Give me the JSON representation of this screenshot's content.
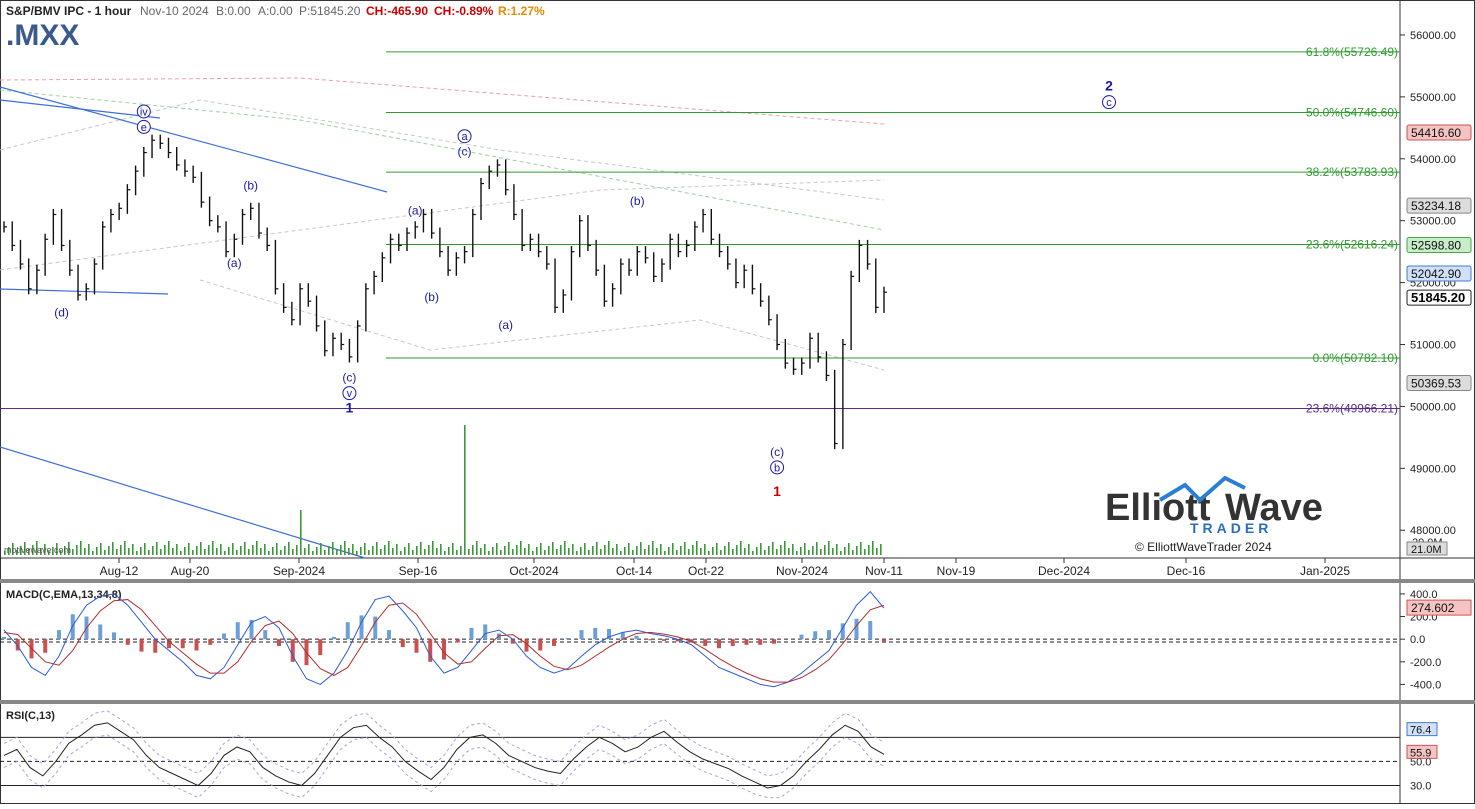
{
  "header": {
    "symbol_line": "S&P/BMV IPC - 1 hour",
    "date": "Nov-10 2024",
    "bid": "B:0.00",
    "ask": "A:0.00",
    "price": "P:51845.20",
    "change_abs": "CH:-465.90",
    "change_pct": "CH:-0.89%",
    "range_pct": "R:1.27%",
    "ticker": ".MXX",
    "watermark": "motivewave.com"
  },
  "colors": {
    "up": "#cc0000",
    "range": "#e68a00",
    "wave_blue": "#1a1aa6",
    "wave_red": "#cc0000",
    "fib_green": "#2e9b2e",
    "fib_purple": "#5a2a8a",
    "trend_blue": "#3d6fd9",
    "macd_line": "#2e5bd9",
    "signal_line": "#b03030",
    "hist_pos": "#6a9fd8",
    "hist_neg": "#c85050",
    "rsi_line": "#222222"
  },
  "logo": {
    "word1": "Elliott",
    "word2": "Wave",
    "word3": "TRADER",
    "copyright": "© ElliottWaveTrader 2024"
  },
  "chart_data": [
    {
      "type": "line",
      "title": "S&P/BMV IPC - 1 hour",
      "ylim": [
        47600,
        56500
      ],
      "x_tick_labels": [
        "Aug-12",
        "Aug-20",
        "Sep-2024",
        "Sep-16",
        "Oct-2024",
        "Oct-14",
        "Oct-22",
        "Nov-2024",
        "Nov-11",
        "Nov-19",
        "Dec-2024",
        "Dec-16",
        "Jan-2025"
      ],
      "y_tick_labels": [
        "56000.00",
        "55000.00",
        "54000.00",
        "53000.00",
        "52000.00",
        "51000.00",
        "50000.00",
        "49000.00",
        "48000.00"
      ],
      "price_series": [
        52900,
        52600,
        52300,
        51900,
        52200,
        52700,
        53100,
        52600,
        52200,
        51800,
        51900,
        52300,
        52900,
        53100,
        53200,
        53500,
        53800,
        54100,
        54300,
        54250,
        54100,
        53900,
        53800,
        53700,
        53300,
        53000,
        52900,
        52500,
        52700,
        53100,
        53200,
        52800,
        52600,
        51900,
        51600,
        51400,
        51900,
        51700,
        51300,
        50900,
        51100,
        51000,
        50800,
        51300,
        51900,
        52100,
        52400,
        52700,
        52600,
        52800,
        52900,
        53100,
        52800,
        52500,
        52200,
        52400,
        52500,
        53100,
        53600,
        53800,
        53900,
        53500,
        53100,
        52600,
        52700,
        52500,
        52300,
        51600,
        51800,
        52500,
        53000,
        52600,
        52200,
        51700,
        51900,
        52300,
        52200,
        52500,
        52400,
        52100,
        52300,
        52700,
        52500,
        52600,
        52900,
        53100,
        52700,
        52500,
        52300,
        52000,
        52200,
        51900,
        51700,
        51400,
        51000,
        50700,
        50600,
        50700,
        51100,
        50800,
        50500,
        49400,
        51000,
        52100,
        52600,
        52300,
        51600,
        51845
      ],
      "fib_levels": [
        {
          "label": "61.8%(55726.49)",
          "value": 55726.49
        },
        {
          "label": "50.0%(54746.60)",
          "value": 54746.6
        },
        {
          "label": "38.2%(53783.93)",
          "value": 53783.93
        },
        {
          "label": "23.6%(52616.24)",
          "value": 52616.24
        },
        {
          "label": "0.0%(50782.10)",
          "value": 50782.1
        },
        {
          "label": "23.6%(49966.21)",
          "value": 49966.21
        }
      ],
      "price_tags": [
        {
          "label": "54416.60",
          "value": 54416.6,
          "style": "red"
        },
        {
          "label": "53234.18",
          "value": 53234.18,
          "style": "gray"
        },
        {
          "label": "52598.80",
          "value": 52598.8,
          "style": "green"
        },
        {
          "label": "52042.90",
          "value": 52042.9,
          "style": "blue"
        },
        {
          "label": "51845.20",
          "value": 51845.2,
          "style": "last"
        },
        {
          "label": "50369.53",
          "value": 50369.53,
          "style": "gray"
        }
      ],
      "volume_labels": [
        "29.0M",
        "21.0M"
      ],
      "wave_labels": [
        {
          "text": "(d)",
          "x_index": 7,
          "value": 51450,
          "style": "blue"
        },
        {
          "text": "iv",
          "x_index": 17,
          "value": 54700,
          "style": "circle"
        },
        {
          "text": "e",
          "x_index": 17,
          "value": 54450,
          "style": "circle"
        },
        {
          "text": "(a)",
          "x_index": 28,
          "value": 52250,
          "style": "blue"
        },
        {
          "text": "(b)",
          "x_index": 30,
          "value": 53500,
          "style": "blue"
        },
        {
          "text": "(c)",
          "x_index": 42,
          "value": 50400,
          "style": "blue"
        },
        {
          "text": "v",
          "x_index": 42,
          "value": 50150,
          "style": "circle"
        },
        {
          "text": "1",
          "x_index": 42,
          "value": 49900,
          "style": "bold_blue"
        },
        {
          "text": "(a)",
          "x_index": 50,
          "value": 53100,
          "style": "blue"
        },
        {
          "text": "(b)",
          "x_index": 52,
          "value": 51700,
          "style": "blue"
        },
        {
          "text": "a",
          "x_index": 56,
          "value": 54300,
          "style": "circle"
        },
        {
          "text": "(c)",
          "x_index": 56,
          "value": 54050,
          "style": "blue"
        },
        {
          "text": "(a)",
          "x_index": 61,
          "value": 51250,
          "style": "blue"
        },
        {
          "text": "(b)",
          "x_index": 77,
          "value": 53250,
          "style": "blue"
        },
        {
          "text": "(c)",
          "x_index": 94,
          "value": 49200,
          "style": "blue"
        },
        {
          "text": "b",
          "x_index": 94,
          "value": 48950,
          "style": "circle"
        },
        {
          "text": "1",
          "x_index": 94,
          "value": 48550,
          "style": "bold_red"
        },
        {
          "text": "2",
          "x_index": 123,
          "value": 55100,
          "style": "bold_blue"
        },
        {
          "text": "c",
          "x_index": 123,
          "value": 54850,
          "style": "circle"
        }
      ]
    },
    {
      "type": "bar",
      "title": "MACD(C,EMA,13,34,8)",
      "ylim": [
        -520,
        470
      ],
      "y_tick_labels": [
        "400.0",
        "200.0",
        "0.0",
        "-200.0",
        "-400.0"
      ],
      "last_value_label": "274.602",
      "macd": [
        80,
        -60,
        -250,
        -320,
        -150,
        120,
        300,
        380,
        400,
        300,
        150,
        0,
        -100,
        -200,
        -320,
        -350,
        -250,
        -50,
        150,
        200,
        100,
        -150,
        -350,
        -400,
        -300,
        -100,
        150,
        350,
        380,
        250,
        100,
        -150,
        -300,
        -250,
        -100,
        50,
        80,
        0,
        -150,
        -250,
        -300,
        -260,
        -150,
        -50,
        20,
        60,
        80,
        50,
        30,
        0,
        -50,
        -150,
        -250,
        -300,
        -350,
        -400,
        -420,
        -380,
        -300,
        -200,
        -100,
        100,
        300,
        420,
        274.602
      ],
      "signal": [
        60,
        40,
        -80,
        -200,
        -230,
        -100,
        100,
        250,
        340,
        350,
        260,
        120,
        -20,
        -120,
        -220,
        -300,
        -300,
        -200,
        -20,
        120,
        160,
        50,
        -120,
        -260,
        -320,
        -250,
        -60,
        150,
        300,
        320,
        220,
        50,
        -120,
        -220,
        -200,
        -80,
        30,
        40,
        -40,
        -150,
        -240,
        -270,
        -230,
        -150,
        -70,
        0,
        50,
        60,
        45,
        20,
        -20,
        -90,
        -170,
        -240,
        -300,
        -350,
        -380,
        -380,
        -340,
        -270,
        -180,
        -40,
        120,
        260,
        300
      ],
      "hist": [
        20,
        -100,
        -170,
        -120,
        80,
        220,
        200,
        130,
        60,
        -50,
        -110,
        -120,
        -80,
        -80,
        -100,
        -50,
        50,
        150,
        170,
        80,
        -60,
        -200,
        -230,
        -140,
        20,
        150,
        210,
        200,
        80,
        -70,
        -120,
        -200,
        -180,
        -30,
        100,
        130,
        50,
        -40,
        -110,
        -100,
        -60,
        10,
        80,
        100,
        90,
        60,
        30,
        -10,
        -15,
        -20,
        -30,
        -60,
        -80,
        -60,
        -50,
        -50,
        -40,
        0,
        40,
        70,
        80,
        140,
        180,
        160,
        -25
      ]
    },
    {
      "type": "line",
      "title": "RSI(C,13)",
      "ylim": [
        18,
        96
      ],
      "y_tick_labels": [
        "50.0",
        "30.0"
      ],
      "value_tags": [
        "76.4",
        "55.9"
      ],
      "rsi": [
        55,
        60,
        45,
        38,
        50,
        65,
        72,
        80,
        82,
        75,
        68,
        55,
        45,
        40,
        35,
        30,
        40,
        55,
        62,
        58,
        45,
        38,
        33,
        30,
        40,
        55,
        70,
        78,
        80,
        70,
        62,
        50,
        42,
        35,
        45,
        60,
        70,
        72,
        65,
        55,
        50,
        45,
        42,
        40,
        52,
        62,
        70,
        65,
        58,
        62,
        70,
        75,
        66,
        58,
        52,
        48,
        44,
        38,
        33,
        28,
        30,
        38,
        50,
        60,
        72,
        80,
        75,
        62,
        55.9
      ]
    }
  ]
}
